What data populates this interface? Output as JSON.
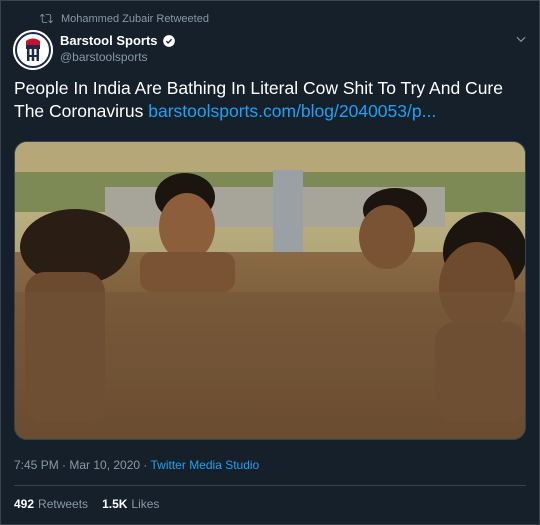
{
  "retweet": {
    "label": "Mohammed Zubair Retweeted",
    "icon": "retweet-icon"
  },
  "author": {
    "name": "Barstool Sports",
    "handle": "@barstoolsports",
    "verified": true
  },
  "tweet": {
    "text": "People In India Are Bathing In Literal Cow Shit To Try And Cure The Coronavirus ",
    "link": "barstoolsports.com/blog/2040053/p...",
    "media": {
      "type": "photo",
      "description_icon": "photo"
    }
  },
  "meta": {
    "timestamp": "7:45 PM · Mar 10, 2020 · ",
    "source": "Twitter Media Studio"
  },
  "stats": {
    "retweets_count": "492",
    "retweets_label": "Retweets",
    "likes_count": "1.5K",
    "likes_label": "Likes"
  },
  "colors": {
    "background": "#15202b",
    "accent": "#1da1f2",
    "muted": "#8899a6",
    "border": "#38444d"
  }
}
